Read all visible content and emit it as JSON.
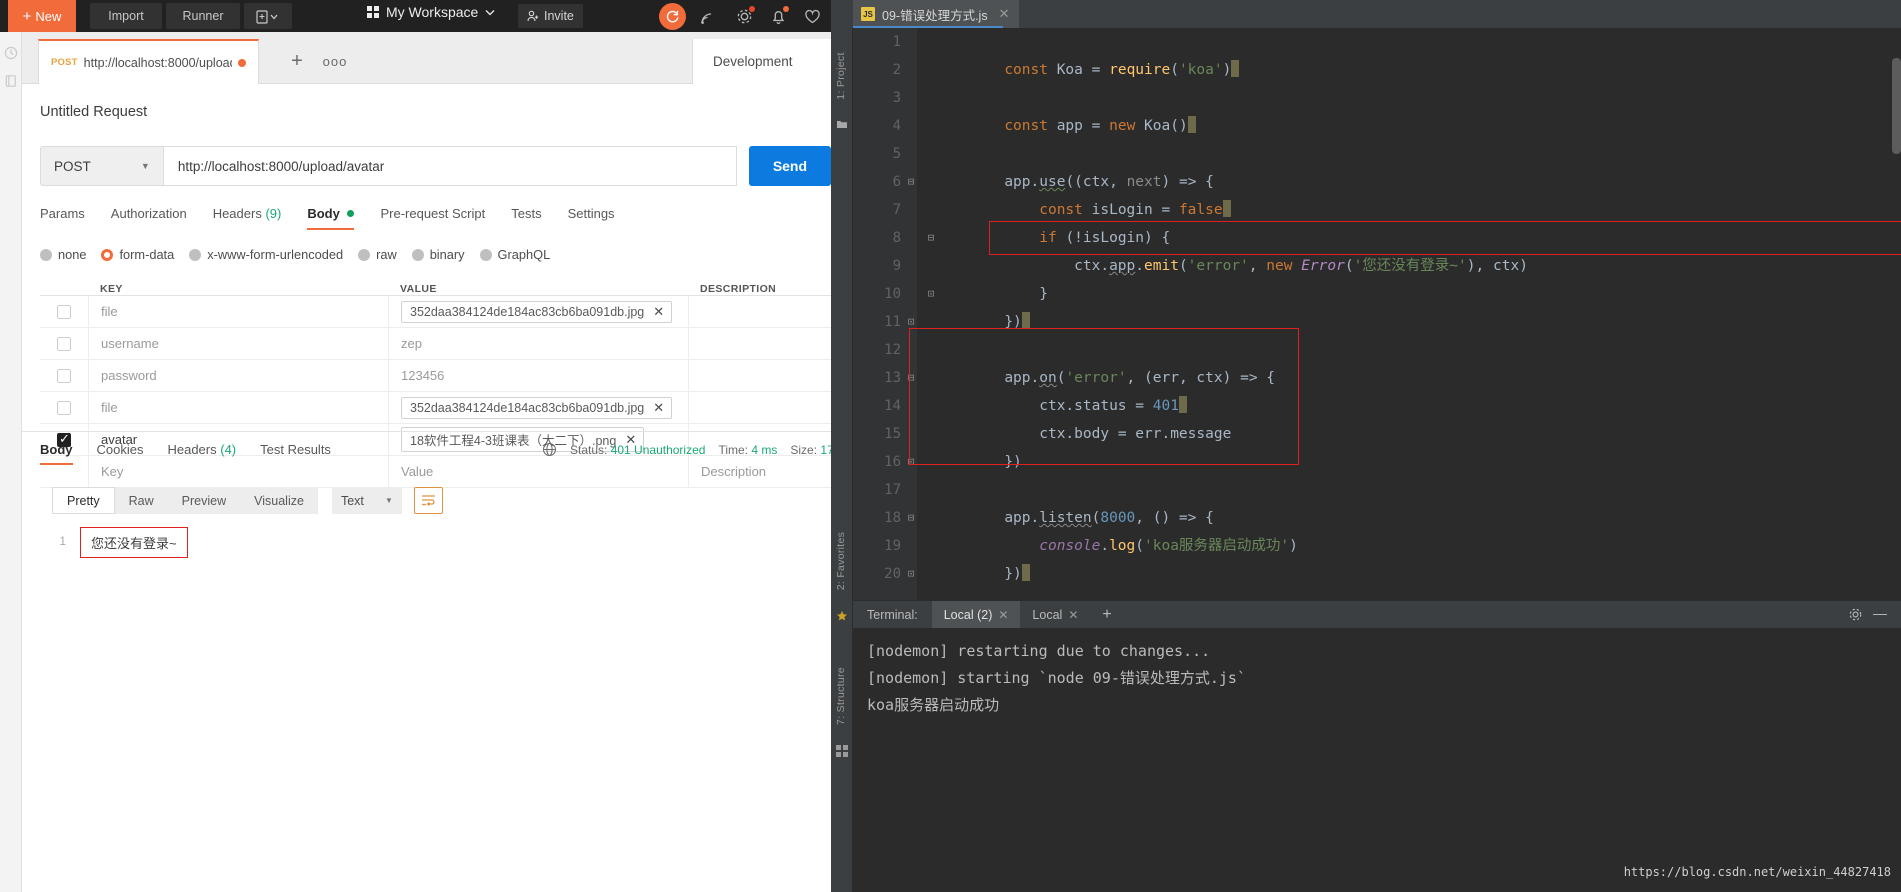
{
  "postman": {
    "topbar": {
      "new_label": "New",
      "import_label": "Import",
      "runner_label": "Runner",
      "workspace_label": "My Workspace",
      "invite_label": "Invite"
    },
    "tab": {
      "method": "POST",
      "url": "http://localhost:8000/upload/...",
      "plus": "+",
      "more": "●●●"
    },
    "environment": "Development",
    "request": {
      "title": "Untitled Request",
      "method": "POST",
      "url": "http://localhost:8000/upload/avatar",
      "send_label": "Send",
      "tabs": [
        {
          "label": "Params",
          "active": false
        },
        {
          "label": "Authorization",
          "active": false
        },
        {
          "label": "Headers",
          "count": "(9)",
          "active": false
        },
        {
          "label": "Body",
          "active": true
        },
        {
          "label": "Pre-request Script",
          "active": false
        },
        {
          "label": "Tests",
          "active": false
        },
        {
          "label": "Settings",
          "active": false
        }
      ],
      "body_types": [
        {
          "label": "none",
          "selected": false
        },
        {
          "label": "form-data",
          "selected": true
        },
        {
          "label": "x-www-form-urlencoded",
          "selected": false
        },
        {
          "label": "raw",
          "selected": false
        },
        {
          "label": "binary",
          "selected": false
        },
        {
          "label": "GraphQL",
          "selected": false
        }
      ],
      "table": {
        "headers": [
          "KEY",
          "VALUE",
          "DESCRIPTION"
        ],
        "rows": [
          {
            "checked": false,
            "key": "file",
            "value": "352daa384124de184ac83cb6ba091db.jpg",
            "is_file": true,
            "desc": ""
          },
          {
            "checked": false,
            "key": "username",
            "value": "zep",
            "is_file": false,
            "desc": ""
          },
          {
            "checked": false,
            "key": "password",
            "value": "123456",
            "is_file": false,
            "desc": ""
          },
          {
            "checked": false,
            "key": "file",
            "value": "352daa384124de184ac83cb6ba091db.jpg",
            "is_file": true,
            "desc": ""
          },
          {
            "checked": true,
            "key": "avatar",
            "value": "18软件工程4-3班课表（大二下）.png",
            "is_file": true,
            "desc": ""
          }
        ],
        "placeholder_row": {
          "key": "Key",
          "value": "Value",
          "desc": "Description"
        }
      }
    },
    "response": {
      "tabs": [
        {
          "label": "Body",
          "active": true
        },
        {
          "label": "Cookies",
          "active": false
        },
        {
          "label": "Headers",
          "count": "(4)",
          "active": false
        },
        {
          "label": "Test Results",
          "active": false
        }
      ],
      "status_label": "Status:",
      "status_value": "401 Unauthorized",
      "time_label": "Time:",
      "time_value": "4 ms",
      "size_label": "Size:",
      "size_value": "17",
      "view_tabs": [
        {
          "label": "Pretty",
          "active": true
        },
        {
          "label": "Raw",
          "active": false
        },
        {
          "label": "Preview",
          "active": false
        },
        {
          "label": "Visualize",
          "active": false
        }
      ],
      "format": "Text",
      "body_line_number": "1",
      "body_text": "您还没有登录~"
    }
  },
  "ide": {
    "tab_filename": "09-错误处理方式.js",
    "tab_filetype": "JS",
    "rails": {
      "project": "1: Project",
      "favorites": "2: Favorites",
      "structure": "7: Structure"
    },
    "code_lines": [
      {
        "n": "1",
        "text": "const Koa = require('koa')"
      },
      {
        "n": "2",
        "text": ""
      },
      {
        "n": "3",
        "text": "const app = new Koa()"
      },
      {
        "n": "4",
        "text": ""
      },
      {
        "n": "5",
        "text": "app.use((ctx, next) => {"
      },
      {
        "n": "6",
        "text": "    const isLogin = false"
      },
      {
        "n": "7",
        "text": "    if (!isLogin) {"
      },
      {
        "n": "8",
        "text": "        ctx.app.emit('error', new Error('您还没有登录~'), ctx)"
      },
      {
        "n": "9",
        "text": "    }"
      },
      {
        "n": "10",
        "text": "})"
      },
      {
        "n": "11",
        "text": ""
      },
      {
        "n": "12",
        "text": "app.on('error', (err, ctx) => {"
      },
      {
        "n": "13",
        "text": "    ctx.status = 401"
      },
      {
        "n": "14",
        "text": "    ctx.body = err.message"
      },
      {
        "n": "15",
        "text": "})"
      },
      {
        "n": "16",
        "text": ""
      },
      {
        "n": "17",
        "text": "app.listen(8000, () => {"
      },
      {
        "n": "18",
        "text": "    console.log('koa服务器启动成功')"
      },
      {
        "n": "19",
        "text": "})"
      },
      {
        "n": "20",
        "text": ""
      }
    ],
    "terminal": {
      "label": "Terminal:",
      "tabs": [
        {
          "label": "Local (2)",
          "active": true
        },
        {
          "label": "Local",
          "active": false
        }
      ],
      "add_label": "+",
      "output": [
        "[nodemon] restarting due to changes...",
        "[nodemon] starting `node 09-错误处理方式.js`",
        "koa服务器启动成功"
      ]
    },
    "watermark": "https://blog.csdn.net/weixin_44827418"
  },
  "colors": {
    "accent_orange": "#f26b3a",
    "send_blue": "#0d7ae0",
    "status_green": "#19a974",
    "error_red": "#e02020"
  }
}
